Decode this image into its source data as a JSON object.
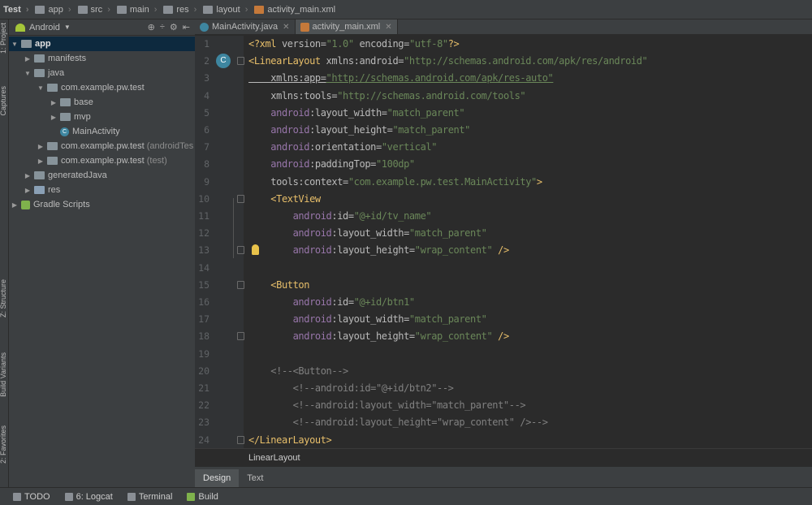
{
  "breadcrumbs": [
    {
      "label": "Test",
      "icon": "project-icon"
    },
    {
      "label": "app",
      "icon": "folder-icon"
    },
    {
      "label": "src",
      "icon": "folder-icon"
    },
    {
      "label": "main",
      "icon": "folder-icon"
    },
    {
      "label": "res",
      "icon": "folder-icon"
    },
    {
      "label": "layout",
      "icon": "folder-icon"
    },
    {
      "label": "activity_main.xml",
      "icon": "xml-file-icon"
    }
  ],
  "left_strip": {
    "project": "1: Project",
    "captures": "Captures",
    "structure": "Z: Structure",
    "build_variants": "Build Variants",
    "favorites": "2: Favorites"
  },
  "project_panel": {
    "view": "Android"
  },
  "tree": [
    {
      "label": "app",
      "bold": true
    },
    {
      "label": "manifests"
    },
    {
      "label": "java"
    },
    {
      "label": "com.example.pw.test"
    },
    {
      "label": "base"
    },
    {
      "label": "mvp"
    },
    {
      "label": "MainActivity"
    },
    {
      "label": "com.example.pw.test",
      "suffix": "(androidTes"
    },
    {
      "label": "com.example.pw.test",
      "suffix": "(test)"
    },
    {
      "label": "generatedJava"
    },
    {
      "label": "res"
    },
    {
      "label": "Gradle Scripts"
    }
  ],
  "tabs": [
    {
      "label": "MainActivity.java",
      "active": false
    },
    {
      "label": "activity_main.xml",
      "active": true
    }
  ],
  "code_lines": [
    {
      "n": "1",
      "segs": [
        [
          "punc",
          "<?"
        ],
        [
          "tag",
          "xml "
        ],
        [
          "attr",
          "version="
        ],
        [
          "val",
          "\"1.0\" "
        ],
        [
          "attr",
          "encoding="
        ],
        [
          "val",
          "\"utf-8\""
        ],
        [
          "punc",
          "?>"
        ]
      ]
    },
    {
      "n": "2",
      "segs": [
        [
          "tag",
          "<LinearLayout "
        ],
        [
          "attr",
          "xmlns:android="
        ],
        [
          "val",
          "\"http://schemas.android.com/apk/res/android\""
        ]
      ]
    },
    {
      "n": "3",
      "segs": [
        [
          "attr",
          "    xmlns:app="
        ],
        [
          "val",
          "\"http://schemas.android.com/apk/res-auto\""
        ]
      ]
    },
    {
      "n": "4",
      "segs": [
        [
          "attr",
          "    xmlns:tools="
        ],
        [
          "val",
          "\"http://schemas.android.com/tools\""
        ]
      ]
    },
    {
      "n": "5",
      "segs": [
        [
          "ns",
          "    android"
        ],
        [
          "attr",
          ":layout_width="
        ],
        [
          "val",
          "\"match_parent\""
        ]
      ]
    },
    {
      "n": "6",
      "segs": [
        [
          "ns",
          "    android"
        ],
        [
          "attr",
          ":layout_height="
        ],
        [
          "val",
          "\"match_parent\""
        ]
      ]
    },
    {
      "n": "7",
      "segs": [
        [
          "ns",
          "    android"
        ],
        [
          "attr",
          ":orientation="
        ],
        [
          "val",
          "\"vertical\""
        ]
      ]
    },
    {
      "n": "8",
      "segs": [
        [
          "ns",
          "    android"
        ],
        [
          "attr",
          ":paddingTop="
        ],
        [
          "val",
          "\"100dp\""
        ]
      ]
    },
    {
      "n": "9",
      "segs": [
        [
          "attr",
          "    tools:context="
        ],
        [
          "val",
          "\"com.example.pw.test.MainActivity\""
        ],
        [
          "tag",
          ">"
        ]
      ]
    },
    {
      "n": "10",
      "segs": [
        [
          "tag",
          "    <TextView"
        ]
      ]
    },
    {
      "n": "11",
      "segs": [
        [
          "ns",
          "        android"
        ],
        [
          "attr",
          ":id="
        ],
        [
          "val",
          "\"@+id/tv_name\""
        ]
      ]
    },
    {
      "n": "12",
      "segs": [
        [
          "ns",
          "        android"
        ],
        [
          "attr",
          ":layout_width="
        ],
        [
          "val",
          "\"match_parent\""
        ]
      ]
    },
    {
      "n": "13",
      "segs": [
        [
          "ns",
          "        android"
        ],
        [
          "attr",
          ":layout_height="
        ],
        [
          "val",
          "\"wrap_content\" "
        ],
        [
          "tag",
          "/>"
        ]
      ]
    },
    {
      "n": "14",
      "segs": []
    },
    {
      "n": "15",
      "segs": [
        [
          "tag",
          "    <Button"
        ]
      ]
    },
    {
      "n": "16",
      "segs": [
        [
          "ns",
          "        android"
        ],
        [
          "attr",
          ":id="
        ],
        [
          "val",
          "\"@+id/btn1\""
        ]
      ]
    },
    {
      "n": "17",
      "segs": [
        [
          "ns",
          "        android"
        ],
        [
          "attr",
          ":layout_width="
        ],
        [
          "val",
          "\"match_parent\""
        ]
      ]
    },
    {
      "n": "18",
      "segs": [
        [
          "ns",
          "        android"
        ],
        [
          "attr",
          ":layout_height="
        ],
        [
          "val",
          "\"wrap_content\" "
        ],
        [
          "tag",
          "/>"
        ]
      ]
    },
    {
      "n": "19",
      "segs": []
    },
    {
      "n": "20",
      "segs": [
        [
          "cmt",
          "    <!--<Button-->"
        ]
      ]
    },
    {
      "n": "21",
      "segs": [
        [
          "cmt",
          "        <!--android:id=\"@+id/btn2\"-->"
        ]
      ]
    },
    {
      "n": "22",
      "segs": [
        [
          "cmt",
          "        <!--android:layout_width=\"match_parent\"-->"
        ]
      ]
    },
    {
      "n": "23",
      "segs": [
        [
          "cmt",
          "        <!--android:layout_height=\"wrap_content\" />-->"
        ]
      ]
    },
    {
      "n": "24",
      "segs": [
        [
          "tag",
          "</LinearLayout>"
        ]
      ]
    }
  ],
  "editor_breadcrumb": "LinearLayout",
  "design_tabs": {
    "design": "Design",
    "text": "Text"
  },
  "status_bar": [
    {
      "label": "TODO",
      "icon": "todo-icon"
    },
    {
      "label": "6: Logcat",
      "icon": "logcat-icon"
    },
    {
      "label": "Terminal",
      "icon": "terminal-icon"
    },
    {
      "label": "Build",
      "icon": "build-icon"
    }
  ],
  "colors": {
    "tag": "#e8bf6a",
    "attr": "#bababa",
    "value": "#6a8759",
    "comment": "#808080",
    "namespace": "#9876aa",
    "background": "#2b2b2b"
  }
}
